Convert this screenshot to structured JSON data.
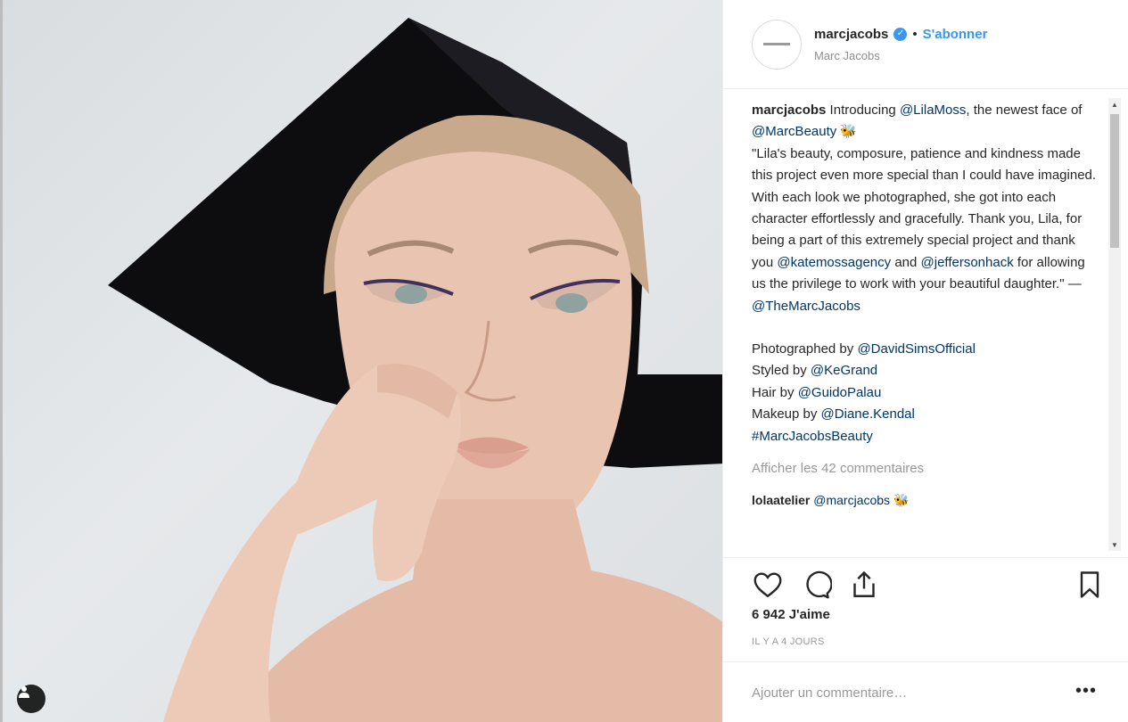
{
  "post": {
    "image_alt": "Marc Jacobs Beauty campaign portrait",
    "tag_icon": "user-tag-icon"
  },
  "header": {
    "username": "marcjacobs",
    "verified_icon": "verified-badge-icon",
    "separator": "•",
    "follow_label": "S'abonner",
    "subname": "Marc Jacobs"
  },
  "caption": {
    "username": "marcjacobs",
    "intro": " Introducing ",
    "mention_lila": "@LilaMoss",
    "text_1": ", the newest face of ",
    "mention_beauty": "@MarcBeauty",
    "emoji": " 🐝",
    "quote": "\"Lila's beauty, composure, patience and kindness made this project even more special than I could have imagined. With each look we photographed, she got into each character effortlessly and gracefully. Thank you, Lila, for being a part of this extremely special project and thank you ",
    "mention_kate": "@katemossagency",
    "and": " and ",
    "mention_jefferson": "@jeffersonhack",
    "text_2": " for allowing us the privilege to work with your beautiful daughter.\" — ",
    "mention_themarc": "@TheMarcJacobs"
  },
  "credits": [
    {
      "label": "Photographed by ",
      "mention": "@DavidSimsOfficial"
    },
    {
      "label": "Styled by ",
      "mention": "@KeGrand"
    },
    {
      "label": "Hair by ",
      "mention": "@GuidoPalau"
    },
    {
      "label": "Makeup by ",
      "mention": "@Diane.Kendal"
    }
  ],
  "hashtag": "#MarcJacobsBeauty",
  "view_comments": "Afficher les 42 commentaires",
  "reply": {
    "username": "lolaatelier",
    "mention": "@marcjacobs",
    "emoji": " 🐝"
  },
  "scrollbar": {
    "up": "▲",
    "down": "▼"
  },
  "actions": {
    "like_icon": "heart-icon",
    "comment_icon": "comment-icon",
    "share_icon": "share-icon",
    "save_icon": "bookmark-icon"
  },
  "likes": "6 942 J'aime",
  "time_ago": "IL Y A 4 JOURS",
  "comment_input": {
    "placeholder": "Ajouter un commentaire…"
  },
  "more_label": "•••",
  "colors": {
    "link": "#003569",
    "accent": "#3897f0",
    "muted": "#999999"
  }
}
